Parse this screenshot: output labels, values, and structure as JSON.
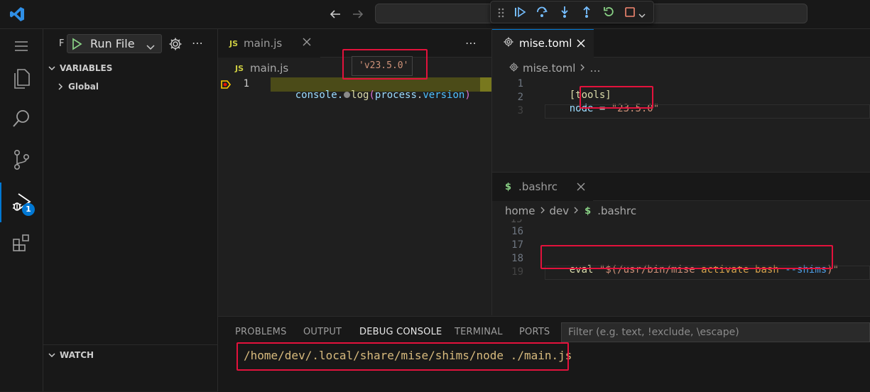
{
  "title_bar": {
    "search_placeholder": ""
  },
  "activity_bar": {
    "debug_badge": "1"
  },
  "sidebar": {
    "header_letter": "F",
    "run_label": "Run File",
    "variables_label": "VARIABLES",
    "global_label": "Global",
    "watch_label": "WATCH"
  },
  "left_editor": {
    "tab_icon": "JS",
    "tab_label": "main.js",
    "breadcrumb_icon": "JS",
    "breadcrumb_file": "main.js",
    "hover_value": "'v23.5.0'",
    "line_number": "1",
    "code": {
      "t1": "console.",
      "t2": "log",
      "t3": "(",
      "t4": "process",
      "t5": ".",
      "t6": "version",
      "t7": ")"
    }
  },
  "right_top_editor": {
    "tab_label": "mise.toml",
    "breadcrumb_file": "mise.toml",
    "breadcrumb_rest": "…",
    "lines": [
      {
        "num": "1",
        "a": "[tools]"
      },
      {
        "num": "2",
        "a": "node",
        "b": " = ",
        "c": "\"23.5.0\""
      },
      {
        "num": "3"
      }
    ]
  },
  "right_bot_editor": {
    "tab_icon": "$",
    "tab_label": ".bashrc",
    "breadcrumb": {
      "home": "home",
      "dev": "dev",
      "icon": "$",
      "file": ".bashrc"
    },
    "lines": [
      {
        "num": "16"
      },
      {
        "num": "17"
      },
      {
        "num": "18",
        "a": "eval ",
        "b": "\"$(/usr/bin/mise ",
        "c": "activate bash ",
        "d": "--shims",
        "e": ")\""
      },
      {
        "num": "19"
      }
    ]
  },
  "panel": {
    "tabs": [
      "PROBLEMS",
      "OUTPUT",
      "DEBUG CONSOLE",
      "TERMINAL",
      "PORTS"
    ],
    "filter_placeholder": "Filter (e.g. text, !exclude, \\escape)",
    "console_output": "/home/dev/.local/share/mise/shims/node ./main.js"
  },
  "colors": {
    "accent": "#0078d4",
    "highlight_red": "#e3123c",
    "string": "#ce9178",
    "debug_line": "#4b4b18"
  }
}
